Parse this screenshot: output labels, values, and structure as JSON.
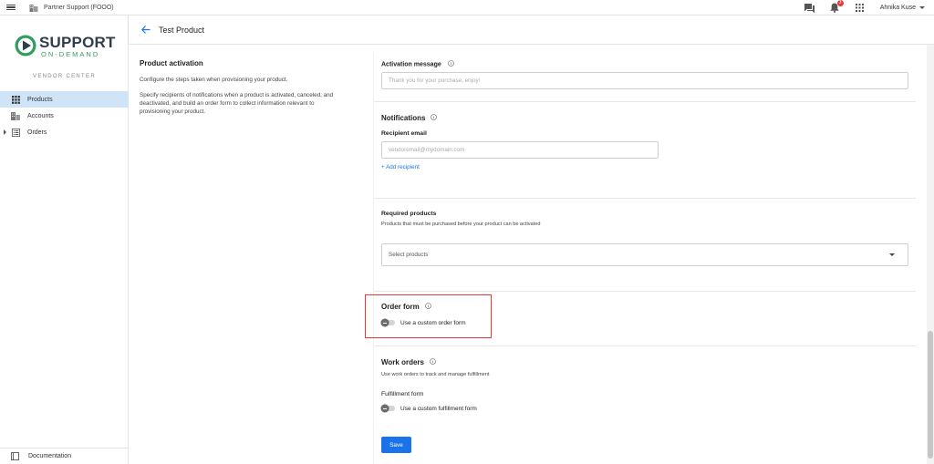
{
  "topbar": {
    "org_name": "Partner Support (FOOO)",
    "notification_count": "3",
    "user_name": "Ahnika Kuse"
  },
  "sidebar": {
    "logo_text": "SUPPORT",
    "logo_subtext": "ON-DEMAND",
    "section_label": "VENDOR CENTER",
    "items": [
      {
        "label": "Products",
        "icon": "grid-icon",
        "active": true
      },
      {
        "label": "Accounts",
        "icon": "building-icon",
        "active": false
      },
      {
        "label": "Orders",
        "icon": "list-icon",
        "active": false
      }
    ],
    "documentation_label": "Documentation"
  },
  "header": {
    "title": "Test Product"
  },
  "left_column": {
    "title": "Product activation",
    "paragraph1": "Configure the steps taken when provisioning your product.",
    "paragraph2": "Specify recipients of notifications when a product is activated, canceled, and deactivated, and build an order form to collect information relevant to provisioning your product."
  },
  "activation_message": {
    "label": "Activation message",
    "placeholder": "Thank you for your purchase, enjoy!"
  },
  "notifications": {
    "title": "Notifications",
    "recipient_label": "Recipient email",
    "recipient_placeholder": "vendoremail@mydomain.com",
    "add_recipient_label": "+ Add recipient"
  },
  "required_products": {
    "title": "Required products",
    "description": "Products that must be purchased before your product can be activated",
    "select_placeholder": "Select products"
  },
  "order_form": {
    "title": "Order form",
    "toggle_label": "Use a custom order form",
    "toggle_on": false
  },
  "work_orders": {
    "title": "Work orders",
    "description": "Use work orders to track and manage fulfillment",
    "fulfillment_title": "Fulfillment form",
    "toggle_label": "Use a custom fulfillment form",
    "toggle_on": false
  },
  "save_label": "Save",
  "colors": {
    "accent": "#1a73e8",
    "active_nav": "#cfe4f7",
    "logo_green": "#2e9e5b",
    "highlight": "#e53935",
    "badge": "#e5393b"
  }
}
